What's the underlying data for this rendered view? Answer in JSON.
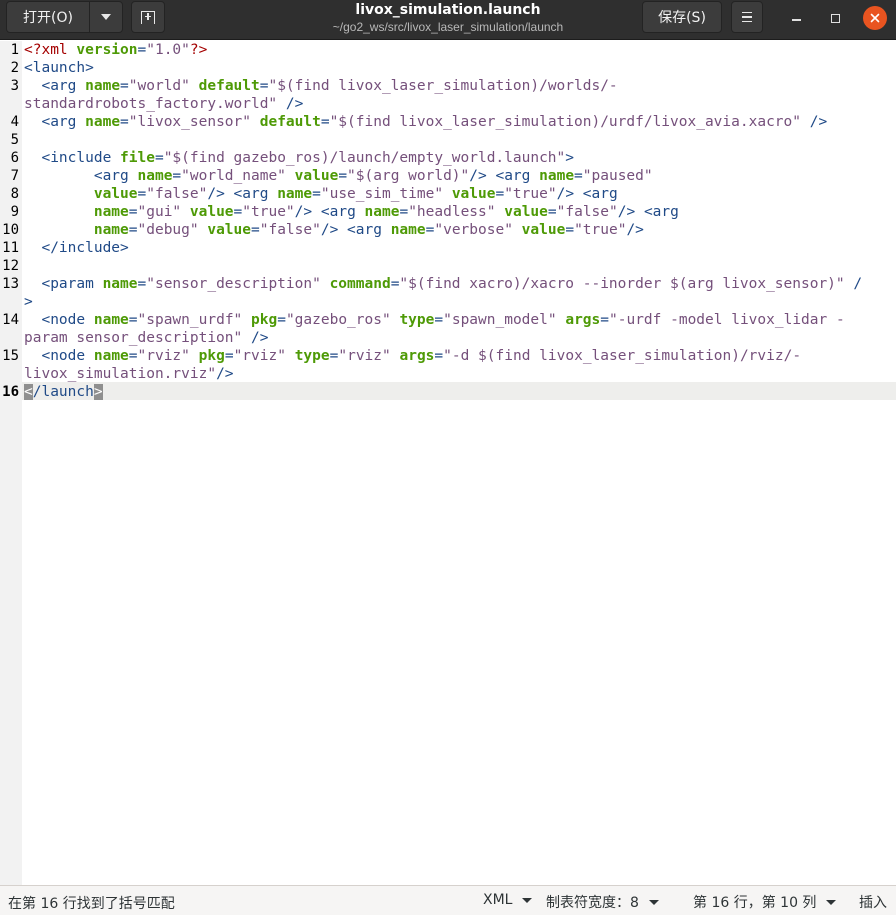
{
  "header": {
    "open_label": "打开(O)",
    "save_label": "保存(S)",
    "title": "livox_simulation.launch",
    "subtitle": "~/go2_ws/src/livox_laser_simulation/launch",
    "icons": {
      "open_menu": "chevron-down-icon",
      "new_tab": "new-tab-icon",
      "menu": "hamburger-menu-icon",
      "minimize": "minimize-icon",
      "maximize": "maximize-icon",
      "close": "close-icon"
    },
    "close_color": "#e95420"
  },
  "editor": {
    "current_line": 16,
    "lines": [
      {
        "n": "1",
        "segs": [
          [
            "pi",
            "<?xml "
          ],
          [
            "attr",
            "version"
          ],
          [
            "tag",
            "="
          ],
          [
            "str",
            "\"1.0\""
          ],
          [
            "pi",
            "?>"
          ]
        ]
      },
      {
        "n": "2",
        "segs": [
          [
            "tag",
            "<launch>"
          ]
        ]
      },
      {
        "n": "3",
        "segs": [
          [
            "plain",
            "  "
          ],
          [
            "tag",
            "<arg "
          ],
          [
            "attr",
            "name"
          ],
          [
            "tag",
            "="
          ],
          [
            "str",
            "\"world\""
          ],
          [
            "plain",
            " "
          ],
          [
            "attr",
            "default"
          ],
          [
            "tag",
            "="
          ],
          [
            "str",
            "\"$(find livox_laser_simulation)/worlds/-"
          ]
        ]
      },
      {
        "n": "",
        "segs": [
          [
            "str",
            "standardrobots_factory.world\""
          ],
          [
            "plain",
            " "
          ],
          [
            "tag",
            "/>"
          ]
        ]
      },
      {
        "n": "4",
        "segs": [
          [
            "plain",
            "  "
          ],
          [
            "tag",
            "<arg "
          ],
          [
            "attr",
            "name"
          ],
          [
            "tag",
            "="
          ],
          [
            "str",
            "\"livox_sensor\""
          ],
          [
            "plain",
            " "
          ],
          [
            "attr",
            "default"
          ],
          [
            "tag",
            "="
          ],
          [
            "str",
            "\"$(find livox_laser_simulation)/urdf/livox_avia.xacro\""
          ],
          [
            "plain",
            " "
          ],
          [
            "tag",
            "/>"
          ]
        ]
      },
      {
        "n": "5",
        "segs": []
      },
      {
        "n": "6",
        "segs": [
          [
            "plain",
            "  "
          ],
          [
            "tag",
            "<include "
          ],
          [
            "attr",
            "file"
          ],
          [
            "tag",
            "="
          ],
          [
            "str",
            "\"$(find gazebo_ros)/launch/empty_world.launch\""
          ],
          [
            "tag",
            ">"
          ]
        ]
      },
      {
        "n": "7",
        "segs": [
          [
            "plain",
            "        "
          ],
          [
            "tag",
            "<arg "
          ],
          [
            "attr",
            "name"
          ],
          [
            "tag",
            "="
          ],
          [
            "str",
            "\"world_name\""
          ],
          [
            "plain",
            " "
          ],
          [
            "attr",
            "value"
          ],
          [
            "tag",
            "="
          ],
          [
            "str",
            "\"$(arg world)\""
          ],
          [
            "tag",
            "/>"
          ],
          [
            "plain",
            " "
          ],
          [
            "tag",
            "<arg "
          ],
          [
            "attr",
            "name"
          ],
          [
            "tag",
            "="
          ],
          [
            "str",
            "\"paused\""
          ]
        ]
      },
      {
        "n": "8",
        "segs": [
          [
            "plain",
            "        "
          ],
          [
            "attr",
            "value"
          ],
          [
            "tag",
            "="
          ],
          [
            "str",
            "\"false\""
          ],
          [
            "tag",
            "/>"
          ],
          [
            "plain",
            " "
          ],
          [
            "tag",
            "<arg "
          ],
          [
            "attr",
            "name"
          ],
          [
            "tag",
            "="
          ],
          [
            "str",
            "\"use_sim_time\""
          ],
          [
            "plain",
            " "
          ],
          [
            "attr",
            "value"
          ],
          [
            "tag",
            "="
          ],
          [
            "str",
            "\"true\""
          ],
          [
            "tag",
            "/>"
          ],
          [
            "plain",
            " "
          ],
          [
            "tag",
            "<arg"
          ]
        ]
      },
      {
        "n": "9",
        "segs": [
          [
            "plain",
            "        "
          ],
          [
            "attr",
            "name"
          ],
          [
            "tag",
            "="
          ],
          [
            "str",
            "\"gui\""
          ],
          [
            "plain",
            " "
          ],
          [
            "attr",
            "value"
          ],
          [
            "tag",
            "="
          ],
          [
            "str",
            "\"true\""
          ],
          [
            "tag",
            "/>"
          ],
          [
            "plain",
            " "
          ],
          [
            "tag",
            "<arg "
          ],
          [
            "attr",
            "name"
          ],
          [
            "tag",
            "="
          ],
          [
            "str",
            "\"headless\""
          ],
          [
            "plain",
            " "
          ],
          [
            "attr",
            "value"
          ],
          [
            "tag",
            "="
          ],
          [
            "str",
            "\"false\""
          ],
          [
            "tag",
            "/>"
          ],
          [
            "plain",
            " "
          ],
          [
            "tag",
            "<arg"
          ]
        ]
      },
      {
        "n": "10",
        "segs": [
          [
            "plain",
            "        "
          ],
          [
            "attr",
            "name"
          ],
          [
            "tag",
            "="
          ],
          [
            "str",
            "\"debug\""
          ],
          [
            "plain",
            " "
          ],
          [
            "attr",
            "value"
          ],
          [
            "tag",
            "="
          ],
          [
            "str",
            "\"false\""
          ],
          [
            "tag",
            "/>"
          ],
          [
            "plain",
            " "
          ],
          [
            "tag",
            "<arg "
          ],
          [
            "attr",
            "name"
          ],
          [
            "tag",
            "="
          ],
          [
            "str",
            "\"verbose\""
          ],
          [
            "plain",
            " "
          ],
          [
            "attr",
            "value"
          ],
          [
            "tag",
            "="
          ],
          [
            "str",
            "\"true\""
          ],
          [
            "tag",
            "/>"
          ]
        ]
      },
      {
        "n": "11",
        "segs": [
          [
            "plain",
            "  "
          ],
          [
            "tag",
            "</include>"
          ]
        ]
      },
      {
        "n": "12",
        "segs": []
      },
      {
        "n": "13",
        "segs": [
          [
            "plain",
            "  "
          ],
          [
            "tag",
            "<param "
          ],
          [
            "attr",
            "name"
          ],
          [
            "tag",
            "="
          ],
          [
            "str",
            "\"sensor_description\""
          ],
          [
            "plain",
            " "
          ],
          [
            "attr",
            "command"
          ],
          [
            "tag",
            "="
          ],
          [
            "str",
            "\"$(find xacro)/xacro --inorder $(arg livox_sensor)\""
          ],
          [
            "plain",
            " "
          ],
          [
            "tag",
            "/"
          ]
        ]
      },
      {
        "n": "",
        "segs": [
          [
            "tag",
            ">"
          ]
        ]
      },
      {
        "n": "14",
        "segs": [
          [
            "plain",
            "  "
          ],
          [
            "tag",
            "<node "
          ],
          [
            "attr",
            "name"
          ],
          [
            "tag",
            "="
          ],
          [
            "str",
            "\"spawn_urdf\""
          ],
          [
            "plain",
            " "
          ],
          [
            "attr",
            "pkg"
          ],
          [
            "tag",
            "="
          ],
          [
            "str",
            "\"gazebo_ros\""
          ],
          [
            "plain",
            " "
          ],
          [
            "attr",
            "type"
          ],
          [
            "tag",
            "="
          ],
          [
            "str",
            "\"spawn_model\""
          ],
          [
            "plain",
            " "
          ],
          [
            "attr",
            "args"
          ],
          [
            "tag",
            "="
          ],
          [
            "str",
            "\"-urdf -model livox_lidar -"
          ]
        ]
      },
      {
        "n": "",
        "segs": [
          [
            "str",
            "param sensor_description\""
          ],
          [
            "plain",
            " "
          ],
          [
            "tag",
            "/>"
          ]
        ]
      },
      {
        "n": "15",
        "segs": [
          [
            "plain",
            "  "
          ],
          [
            "tag",
            "<node "
          ],
          [
            "attr",
            "name"
          ],
          [
            "tag",
            "="
          ],
          [
            "str",
            "\"rviz\""
          ],
          [
            "plain",
            " "
          ],
          [
            "attr",
            "pkg"
          ],
          [
            "tag",
            "="
          ],
          [
            "str",
            "\"rviz\""
          ],
          [
            "plain",
            " "
          ],
          [
            "attr",
            "type"
          ],
          [
            "tag",
            "="
          ],
          [
            "str",
            "\"rviz\""
          ],
          [
            "plain",
            " "
          ],
          [
            "attr",
            "args"
          ],
          [
            "tag",
            "="
          ],
          [
            "str",
            "\"-d $(find livox_laser_simulation)/rviz/-"
          ]
        ]
      },
      {
        "n": "",
        "segs": [
          [
            "str",
            "livox_simulation.rviz\""
          ],
          [
            "tag",
            "/>"
          ]
        ]
      },
      {
        "n": "16",
        "segs": [
          [
            "bracket",
            "<"
          ],
          [
            "tag",
            "/launch"
          ],
          [
            "bracket",
            ">"
          ]
        ]
      }
    ]
  },
  "statusbar": {
    "message": "在第 16 行找到了括号匹配",
    "language": "XML",
    "tab_width": "制表符宽度：8",
    "position": "第 16 行，第 10 列",
    "mode": "插入"
  }
}
